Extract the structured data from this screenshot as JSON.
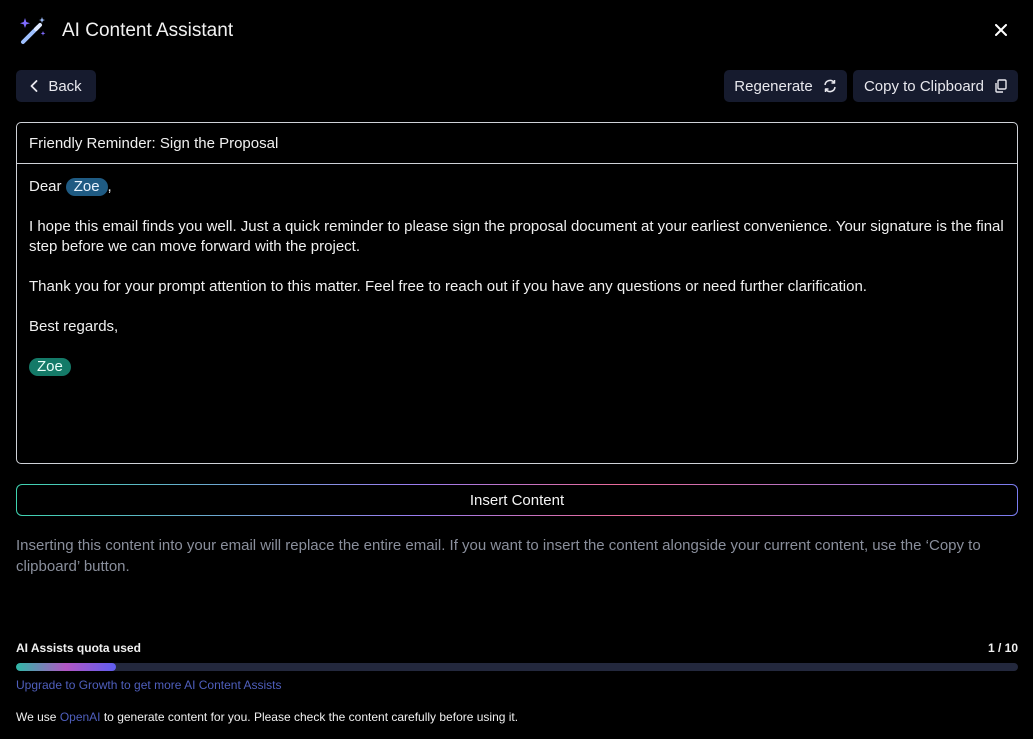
{
  "header": {
    "title": "AI Content Assistant",
    "icon": "magic-wand-icon",
    "close_icon": "close-icon"
  },
  "toolbar": {
    "back_label": "Back",
    "regenerate_label": "Regenerate",
    "copy_label": "Copy to Clipboard"
  },
  "email": {
    "subject": "Friendly Reminder: Sign the Proposal",
    "greeting_prefix": "Dear",
    "recipient": "Zoe",
    "greeting_suffix": ",",
    "paragraph1": "I hope this email finds you well. Just a quick reminder to please sign the proposal document at your earliest convenience. Your signature is the final step before we can move forward with the project.",
    "paragraph2": "Thank you for your prompt attention to this matter. Feel free to reach out if you have any questions or need further clarification.",
    "signoff": "Best regards,",
    "sender": "Zoe"
  },
  "insert": {
    "label": "Insert Content",
    "note": "Inserting this content into your email will replace the entire email. If you want to insert the content alongside your current content, use the ‘Copy to clipboard’ button."
  },
  "quota": {
    "label": "AI Assists quota used",
    "count": "1 / 10",
    "used": 1,
    "total": 10,
    "upgrade": "Upgrade to Growth to get more AI Content Assists"
  },
  "footer": {
    "prefix": "We use ",
    "link": "OpenAI",
    "suffix": " to generate content for you. Please check the content carefully before using it."
  },
  "colors": {
    "background": "#000000",
    "accent_link": "#4f5fbd",
    "chip_blue": "#1f5b83",
    "chip_green": "#147a68",
    "button_bg": "#161b2e"
  }
}
